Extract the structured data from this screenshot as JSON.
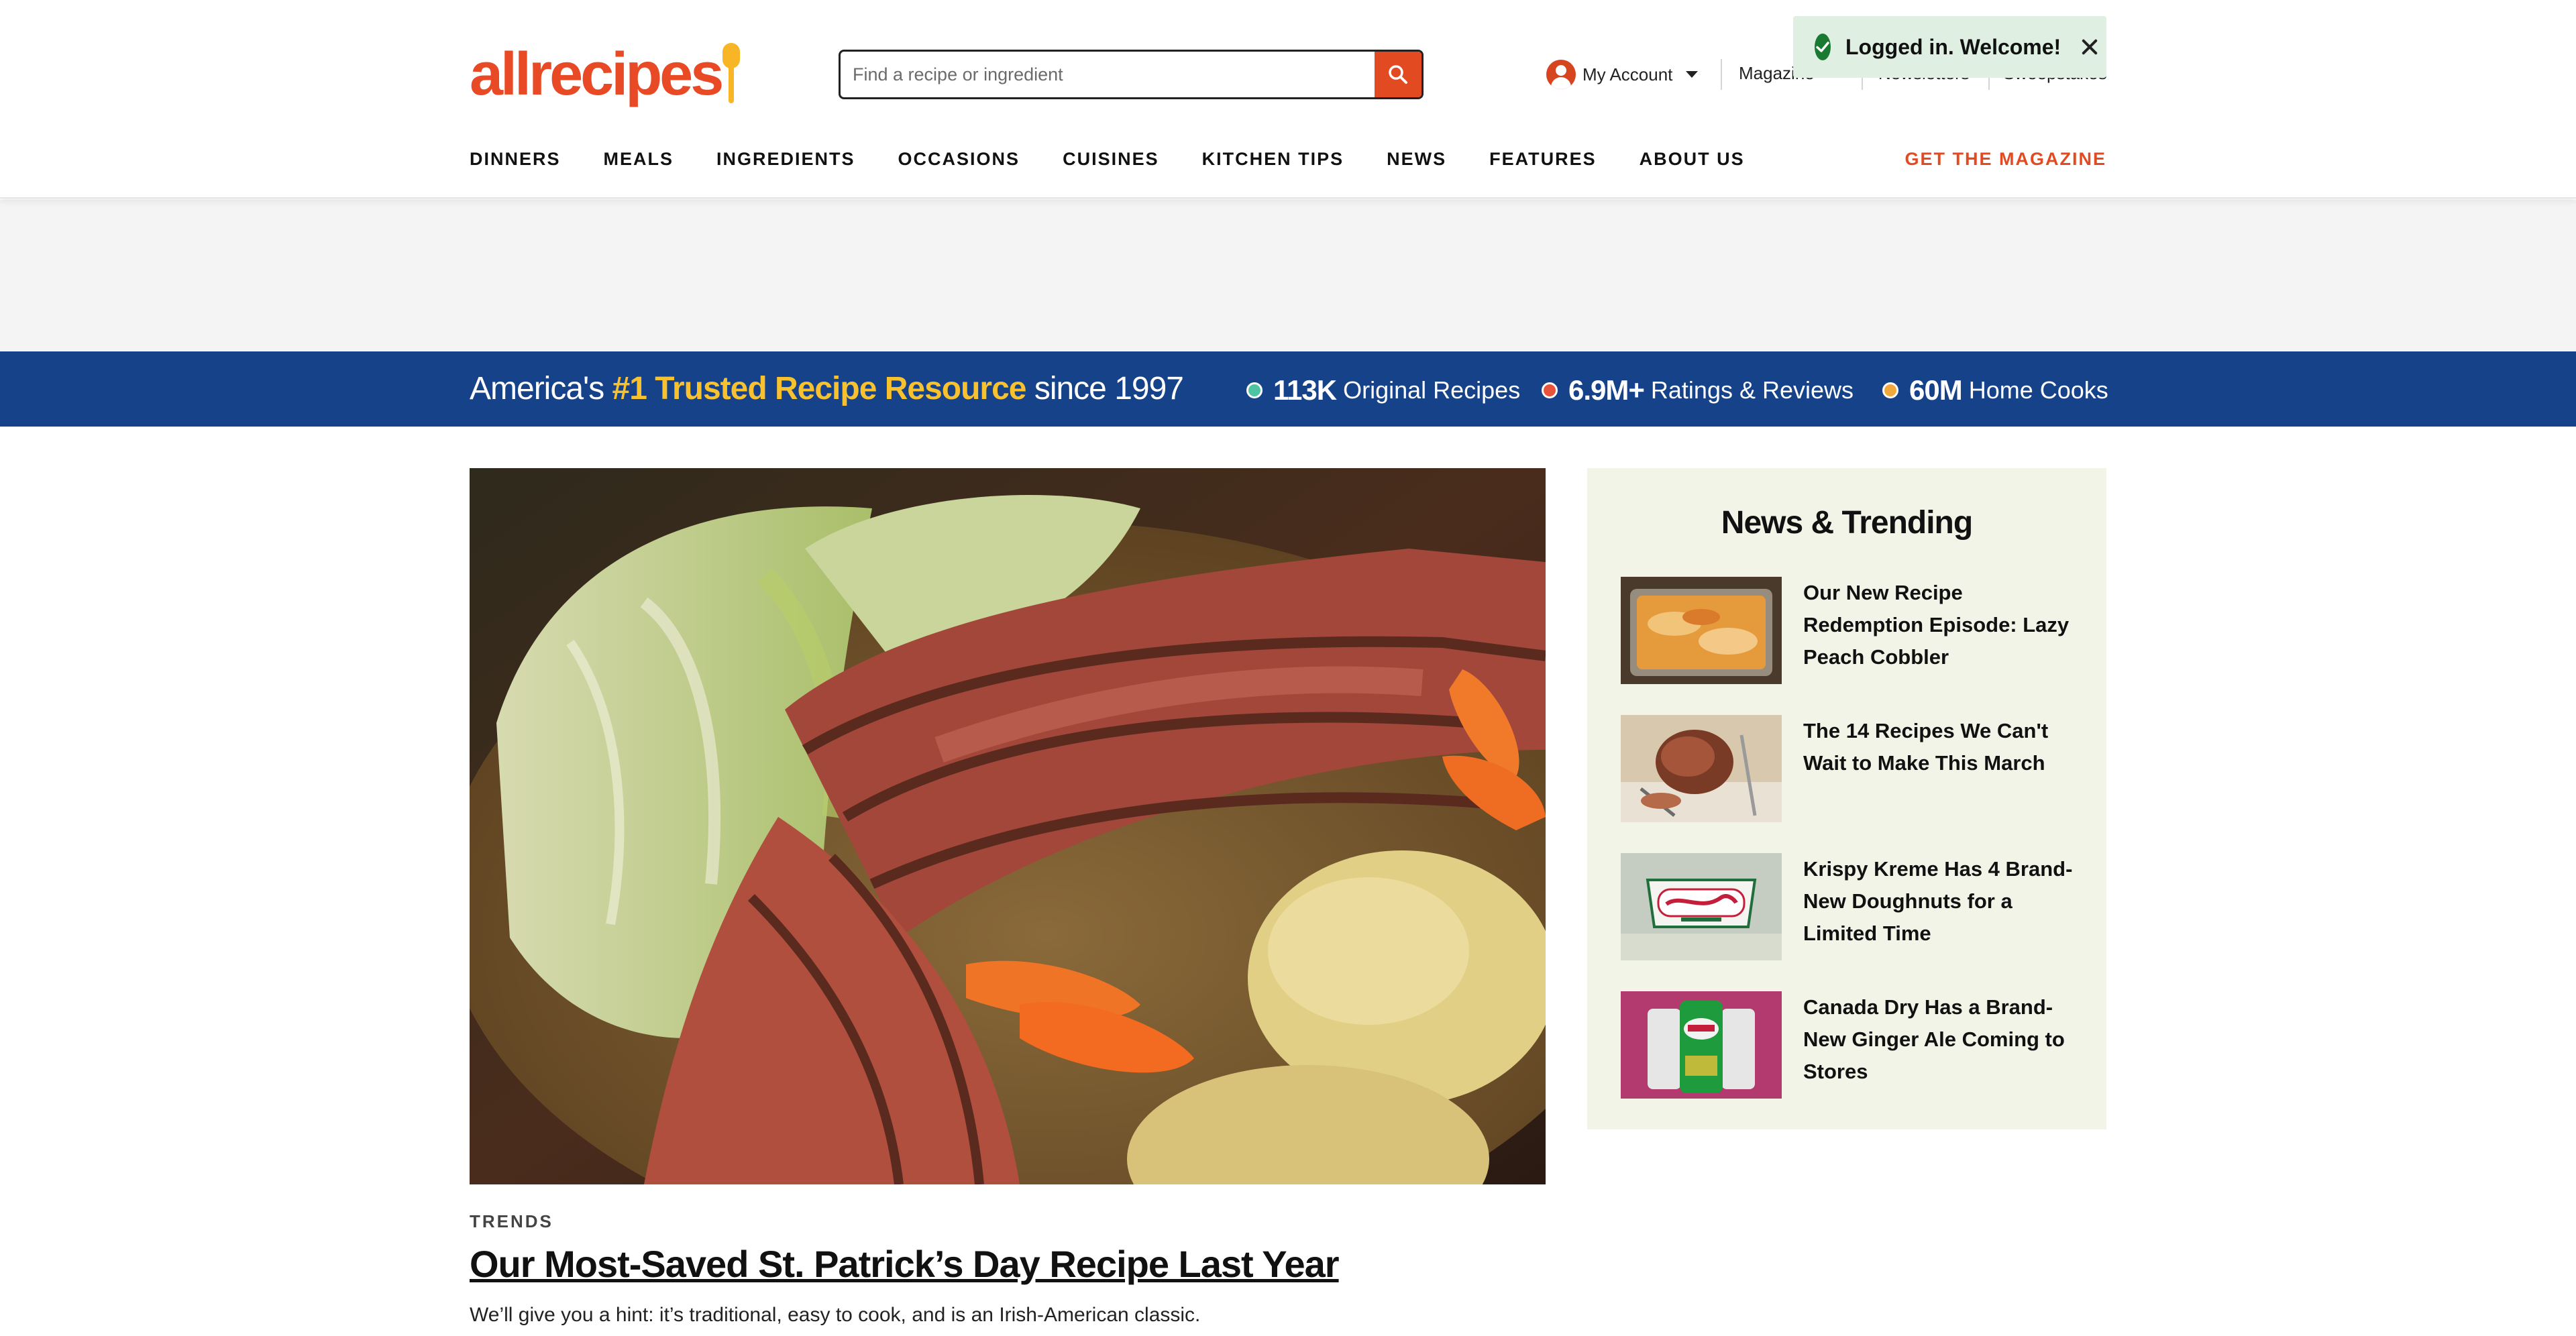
{
  "header": {
    "logo_text": "allrecipes",
    "search": {
      "placeholder": "Find a recipe or ingredient",
      "value": ""
    },
    "account_label": "My Account",
    "utility_links": [
      "Magazine",
      "Newsletters",
      "Sweepstakes"
    ],
    "nav": [
      "DINNERS",
      "MEALS",
      "INGREDIENTS",
      "OCCASIONS",
      "CUISINES",
      "KITCHEN TIPS",
      "NEWS",
      "FEATURES",
      "ABOUT US"
    ],
    "cta": "GET THE MAGAZINE"
  },
  "toast": {
    "message": "Logged in. Welcome!"
  },
  "banner": {
    "prefix": "America's ",
    "highlight": "#1 Trusted Recipe Resource",
    "suffix": " since 1997",
    "stats": [
      {
        "value": "113K",
        "label": "Original Recipes",
        "color": "#4fc4a3"
      },
      {
        "value": "6.9M+",
        "label": "Ratings & Reviews",
        "color": "#e8533a"
      },
      {
        "value": "60M",
        "label": "Home Cooks",
        "color": "#f2a93b"
      }
    ]
  },
  "hero": {
    "kicker": "TRENDS",
    "title": "Our Most-Saved St. Patrick’s Day Recipe Last Year",
    "description": "We’ll give you a hint: it’s traditional, easy to cook, and is an Irish-American classic."
  },
  "trending": {
    "title": "News & Trending",
    "items": [
      {
        "text": "Our New Recipe Redemption Episode: Lazy Peach Cobbler"
      },
      {
        "text": "The 14 Recipes We Can't Wait to Make This March"
      },
      {
        "text": "Krispy Kreme Has 4 Brand-New Doughnuts for a Limited Time"
      },
      {
        "text": "Canada Dry Has a Brand-New Ginger Ale Coming to Stores"
      }
    ]
  },
  "colors": {
    "brand_orange": "#e24a22",
    "logo_spoon": "#f8b627",
    "banner_blue": "#154289",
    "banner_highlight": "#f8c12f",
    "toast_bg": "#dff0e3",
    "trending_bg": "#f2f4e8"
  },
  "icons": {
    "search": "search-icon",
    "account": "user-icon",
    "toast": "check-circle-icon",
    "close": "close-icon"
  }
}
